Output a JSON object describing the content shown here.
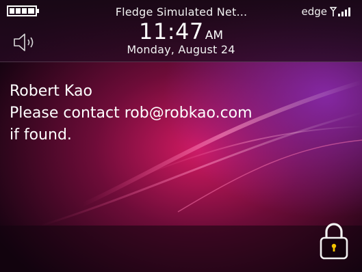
{
  "status_bar": {
    "carrier": "Fledge Simulated Net...",
    "network_type": "edge",
    "battery_icon": "battery-full-icon",
    "signal_icon": "signal-strength-icon",
    "speaker_icon": "speaker-icon"
  },
  "clock": {
    "time": "11:47",
    "ampm": "AM",
    "date": "Monday, August 24"
  },
  "owner": {
    "name": "Robert Kao",
    "message_line1": "Please contact rob@robkao.com",
    "message_line2": "if found."
  },
  "lock": {
    "icon": "padlock-icon",
    "accent": "#f4c400"
  },
  "colors": {
    "wallpaper_dark": "#12030f",
    "wallpaper_magenta": "#c8185e",
    "wallpaper_purple": "#6a1a8c"
  }
}
